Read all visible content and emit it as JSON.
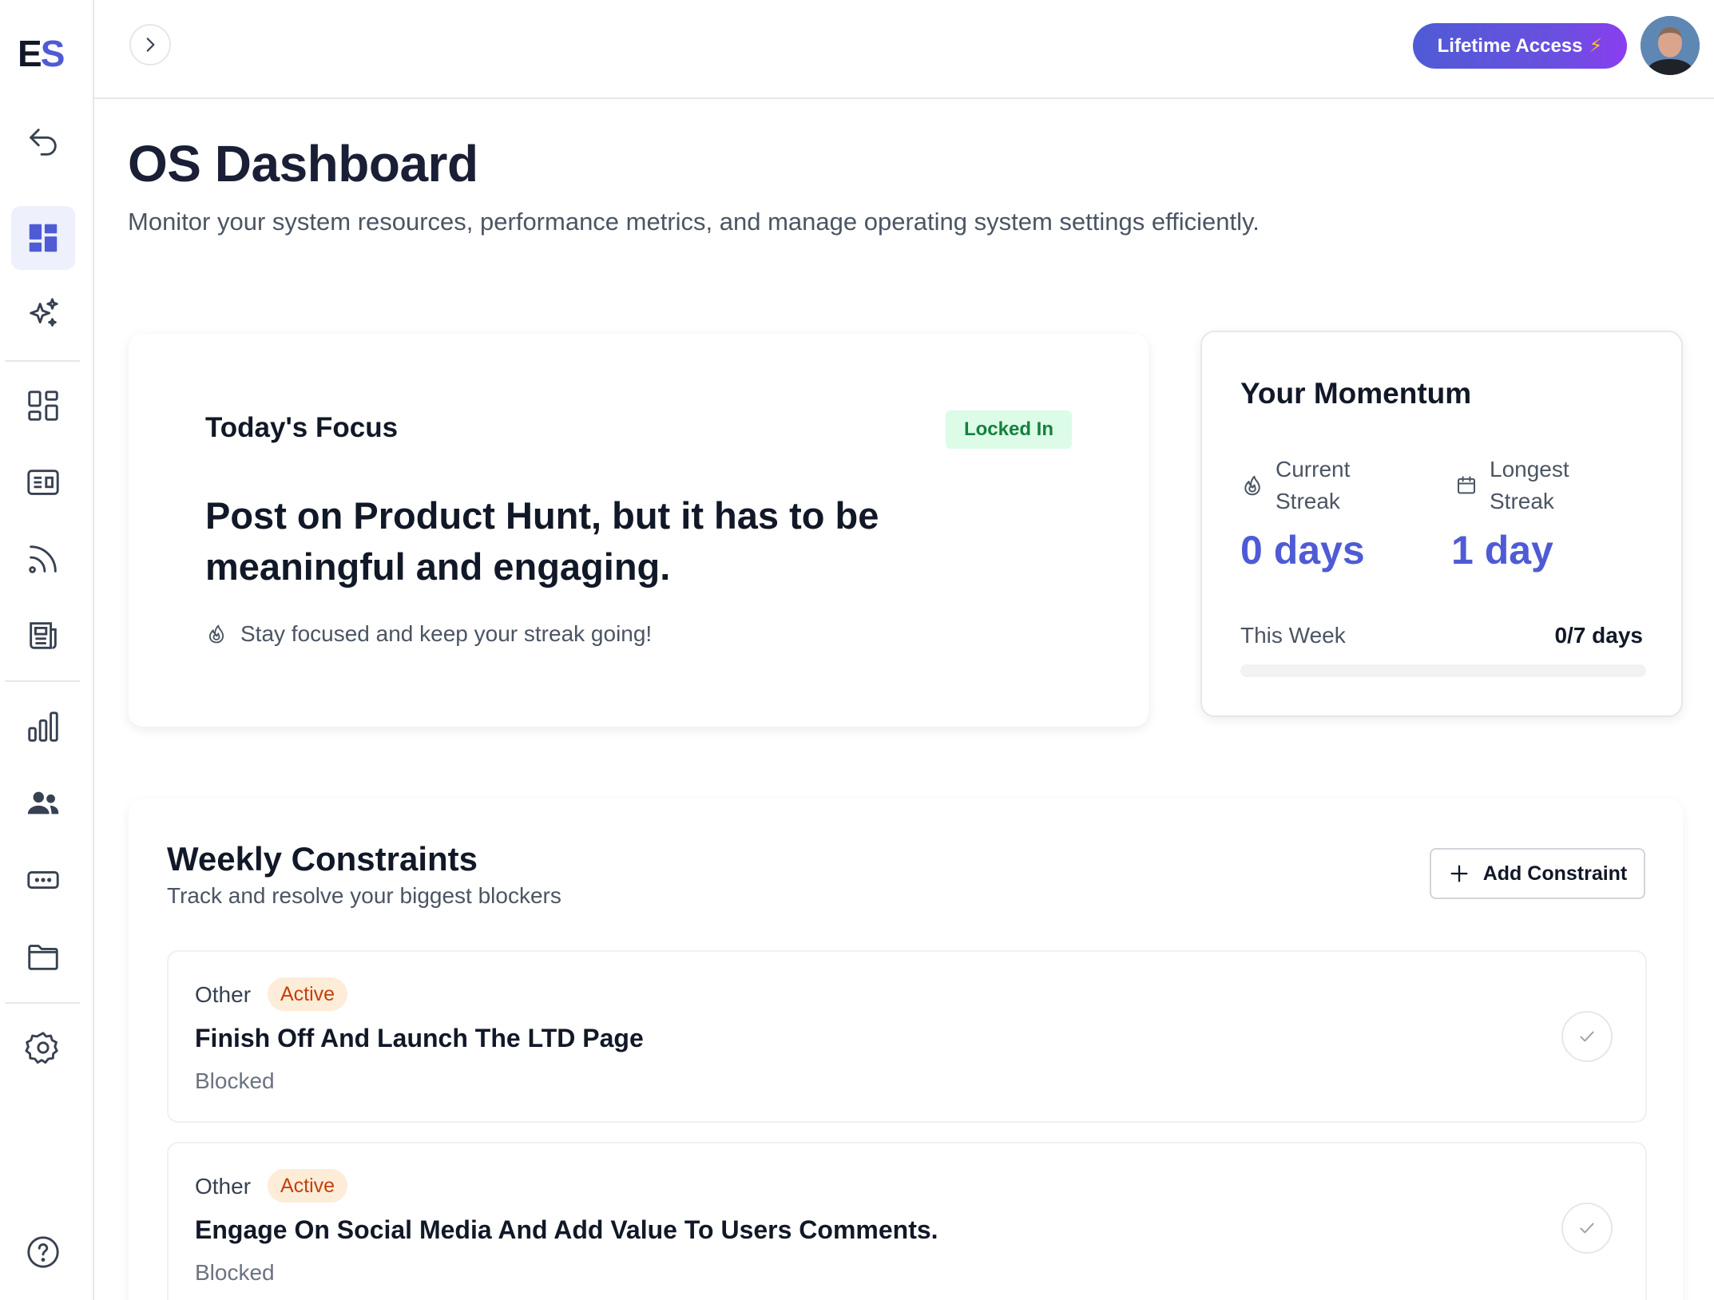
{
  "app": {
    "logo_e": "E",
    "logo_s": "S"
  },
  "sidebar": {
    "items": [
      {
        "icon": "back-arrow-icon"
      },
      {
        "icon": "dashboard-icon",
        "active": true
      },
      {
        "icon": "sparkles-icon"
      },
      {
        "icon": "grid-icon"
      },
      {
        "icon": "media-icon"
      },
      {
        "icon": "rss-icon"
      },
      {
        "icon": "newspaper-icon"
      },
      {
        "icon": "bar-chart-icon"
      },
      {
        "icon": "users-icon"
      },
      {
        "icon": "input-icon"
      },
      {
        "icon": "folder-icon"
      },
      {
        "icon": "settings-icon"
      },
      {
        "icon": "help-icon"
      }
    ]
  },
  "header": {
    "lifetime_label": "Lifetime Access",
    "lifetime_icon": "⚡"
  },
  "page": {
    "title": "OS Dashboard",
    "subtitle": "Monitor your system resources, performance metrics, and manage operating system settings efficiently."
  },
  "focus": {
    "label": "Today's Focus",
    "badge": "Locked In",
    "text": "Post on Product Hunt, but it has to be meaningful and engaging.",
    "note": "Stay focused and keep your streak going!"
  },
  "momentum": {
    "title": "Your Momentum",
    "current_label": "Current Streak",
    "current_value": "0 days",
    "longest_label": "Longest Streak",
    "longest_value": "1 day",
    "week_label": "This Week",
    "week_value": "0/7 days",
    "week_progress": 0
  },
  "constraints": {
    "title": "Weekly Constraints",
    "subtitle": "Track and resolve your biggest blockers",
    "add_label": "Add Constraint",
    "items": [
      {
        "category": "Other",
        "badge": "Active",
        "title": "Finish Off And Launch The LTD Page",
        "status": "Blocked"
      },
      {
        "category": "Other",
        "badge": "Active",
        "title": "Engage On Social Media And Add Value To Users Comments.",
        "status": "Blocked"
      }
    ]
  },
  "colors": {
    "accent": "#4f5bd5",
    "success_bg": "#dcfce7",
    "success_text": "#15803d",
    "warning_bg": "#fdecd8",
    "warning_text": "#c2410c"
  }
}
